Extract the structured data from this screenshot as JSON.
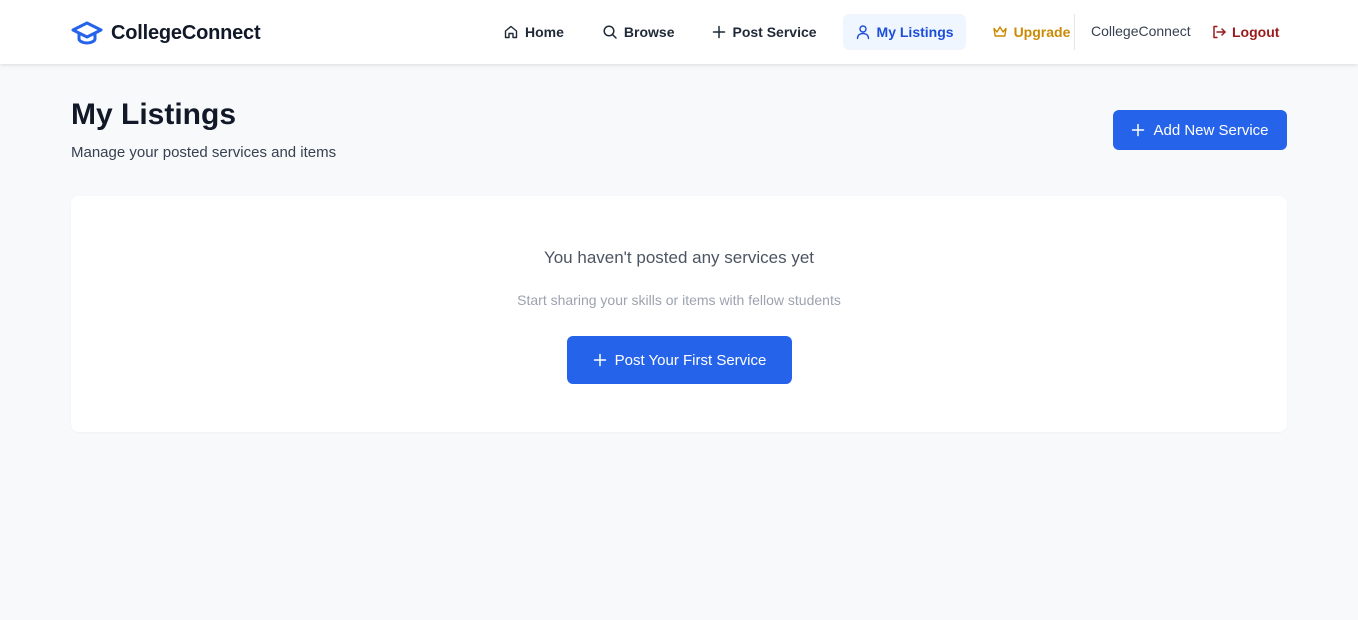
{
  "brand": {
    "name": "CollegeConnect",
    "icon": "graduation-cap-icon",
    "color": "#2563eb"
  },
  "nav": {
    "items": [
      {
        "label": "Home",
        "icon": "home-icon"
      },
      {
        "label": "Browse",
        "icon": "search-icon"
      },
      {
        "label": "Post Service",
        "icon": "plus-icon"
      },
      {
        "label": "My Listings",
        "icon": "user-icon",
        "active": true
      },
      {
        "label": "Upgrade",
        "icon": "crown-icon",
        "color": "#ca8a04"
      }
    ],
    "username": "CollegeConnect",
    "logout_label": "Logout",
    "logout_icon": "logout-icon",
    "logout_color": "#991b1b"
  },
  "header": {
    "title": "My Listings",
    "subtitle": "Manage your posted services and items",
    "add_button_label": "Add New Service"
  },
  "empty_state": {
    "title": "You haven't posted any services yet",
    "subtitle": "Start sharing your skills or items with fellow students",
    "button_label": "Post Your First Service"
  },
  "colors": {
    "primary": "#2563eb",
    "background": "#f8f9fb",
    "active_nav_bg": "#eff6ff"
  }
}
